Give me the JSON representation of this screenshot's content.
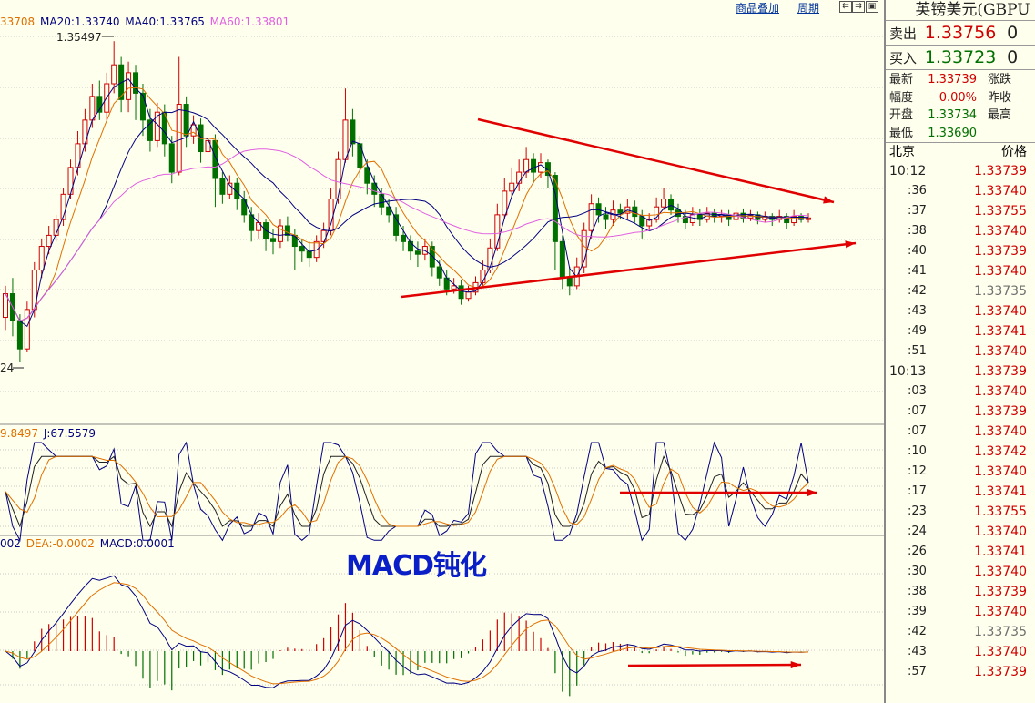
{
  "top_links": [
    "商品叠加",
    "周期"
  ],
  "ma_legend": [
    {
      "text": "33708",
      "color": "#E07000"
    },
    {
      "text": "MA20:1.33740",
      "color": "#000080"
    },
    {
      "text": "MA40:1.33765",
      "color": "#000080"
    },
    {
      "text": "MA60:1.33801",
      "color": "#E060E0"
    }
  ],
  "kdj_legend": [
    {
      "text": "9.8497",
      "color": "#E07000"
    },
    {
      "text": "J:67.5579",
      "color": "#000080"
    }
  ],
  "macd_legend": [
    {
      "text": "002",
      "color": "#000080"
    },
    {
      "text": "DEA:-0.0002",
      "color": "#E07000"
    },
    {
      "text": "MACD:0.0001",
      "color": "#000080"
    }
  ],
  "annotations": {
    "high_label": "1.35497",
    "low_label": "24",
    "macd_text": "MACD钝化"
  },
  "colors": {
    "up": "#D00000",
    "down": "#007000",
    "price_red": "#D00000",
    "price_green": "#007000",
    "price_gray": "#707070",
    "annotation_arrow": "#E00000"
  },
  "side": {
    "title": "英镑美元(GBPU",
    "sell": {
      "label": "卖出",
      "price": "1.33756",
      "vol": "0"
    },
    "buy": {
      "label": "买入",
      "price": "1.33723",
      "vol": "0"
    },
    "stats": [
      {
        "label": "最新",
        "value": "1.33739",
        "color": "#D00000",
        "label2": "涨跌"
      },
      {
        "label": "幅度",
        "value": "0.00%",
        "color": "#D00000",
        "label2": "昨收"
      },
      {
        "label": "开盘",
        "value": "1.33734",
        "color": "#007000",
        "label2": "最高"
      },
      {
        "label": "最低",
        "value": "1.33690",
        "color": "#007000",
        "label2": ""
      }
    ],
    "ticks_header": {
      "left": "北京",
      "right": "价格"
    },
    "ticks": [
      {
        "time": "10:12",
        "price": "1.33739",
        "color": "#D00000",
        "big": true
      },
      {
        "time": ":36",
        "price": "1.33740",
        "color": "#D00000"
      },
      {
        "time": ":37",
        "price": "1.33755",
        "color": "#D00000"
      },
      {
        "time": ":38",
        "price": "1.33740",
        "color": "#D00000"
      },
      {
        "time": ":40",
        "price": "1.33739",
        "color": "#D00000"
      },
      {
        "time": ":41",
        "price": "1.33740",
        "color": "#D00000"
      },
      {
        "time": ":42",
        "price": "1.33735",
        "color": "#707070"
      },
      {
        "time": ":43",
        "price": "1.33740",
        "color": "#D00000"
      },
      {
        "time": ":49",
        "price": "1.33741",
        "color": "#D00000"
      },
      {
        "time": ":51",
        "price": "1.33740",
        "color": "#D00000"
      },
      {
        "time": "10:13",
        "price": "1.33739",
        "color": "#D00000",
        "big": true
      },
      {
        "time": ":03",
        "price": "1.33740",
        "color": "#D00000"
      },
      {
        "time": ":07",
        "price": "1.33739",
        "color": "#D00000"
      },
      {
        "time": ":07",
        "price": "1.33740",
        "color": "#D00000"
      },
      {
        "time": ":10",
        "price": "1.33742",
        "color": "#D00000"
      },
      {
        "time": ":12",
        "price": "1.33740",
        "color": "#D00000"
      },
      {
        "time": ":17",
        "price": "1.33741",
        "color": "#D00000"
      },
      {
        "time": ":23",
        "price": "1.33755",
        "color": "#D00000"
      },
      {
        "time": ":24",
        "price": "1.33740",
        "color": "#D00000"
      },
      {
        "time": ":26",
        "price": "1.33741",
        "color": "#D00000"
      },
      {
        "time": ":30",
        "price": "1.33740",
        "color": "#D00000"
      },
      {
        "time": ":38",
        "price": "1.33739",
        "color": "#D00000"
      },
      {
        "time": ":39",
        "price": "1.33740",
        "color": "#D00000"
      },
      {
        "time": ":42",
        "price": "1.33735",
        "color": "#707070"
      },
      {
        "time": ":43",
        "price": "1.33740",
        "color": "#D00000"
      },
      {
        "time": ":57",
        "price": "1.33739",
        "color": "#D00000"
      }
    ]
  },
  "chart_data": {
    "type": "candlestick",
    "panels": [
      "price",
      "kdj",
      "macd"
    ],
    "candles": [
      [
        0.3,
        0.45,
        0.5,
        0.22
      ],
      [
        0.45,
        0.28,
        0.55,
        0.18
      ],
      [
        0.28,
        0.1,
        0.32,
        0.02
      ],
      [
        0.1,
        0.35,
        0.4,
        0.08
      ],
      [
        0.35,
        0.6,
        0.65,
        0.3
      ],
      [
        0.6,
        0.75,
        0.8,
        0.55
      ],
      [
        0.75,
        0.82,
        0.88,
        0.7
      ],
      [
        0.82,
        0.92,
        0.95,
        0.78
      ],
      [
        0.92,
        1.08,
        1.12,
        0.88
      ],
      [
        1.08,
        1.25,
        1.3,
        1.05
      ],
      [
        1.25,
        1.4,
        1.48,
        1.2
      ],
      [
        1.4,
        1.55,
        1.62,
        1.35
      ],
      [
        1.55,
        1.7,
        1.78,
        1.5
      ],
      [
        1.7,
        1.6,
        1.8,
        1.55
      ],
      [
        1.6,
        1.78,
        1.85,
        1.55
      ],
      [
        1.78,
        1.9,
        2.05,
        1.72
      ],
      [
        1.9,
        1.68,
        1.95,
        1.6
      ],
      [
        1.68,
        1.85,
        1.92,
        1.6
      ],
      [
        1.85,
        1.72,
        1.9,
        1.55
      ],
      [
        1.72,
        1.55,
        1.78,
        1.45
      ],
      [
        1.55,
        1.42,
        1.62,
        1.35
      ],
      [
        1.42,
        1.6,
        1.66,
        1.38
      ],
      [
        1.6,
        1.4,
        1.65,
        1.32
      ],
      [
        1.4,
        1.22,
        1.45,
        1.15
      ],
      [
        1.22,
        1.65,
        1.95,
        1.2
      ],
      [
        1.65,
        1.45,
        1.7,
        1.38
      ],
      [
        1.45,
        1.52,
        1.58,
        1.4
      ],
      [
        1.52,
        1.35,
        1.56,
        1.28
      ],
      [
        1.35,
        1.42,
        1.48,
        1.3
      ],
      [
        1.42,
        1.18,
        1.46,
        1.0
      ],
      [
        1.18,
        1.08,
        1.22,
        1.02
      ],
      [
        1.08,
        1.15,
        1.2,
        1.05
      ],
      [
        1.15,
        1.05,
        1.18,
        0.98
      ],
      [
        1.05,
        0.95,
        1.1,
        0.9
      ],
      [
        0.95,
        0.85,
        1.0,
        0.78
      ],
      [
        0.85,
        0.9,
        0.96,
        0.8
      ],
      [
        0.9,
        0.8,
        0.92,
        0.72
      ],
      [
        0.8,
        0.78,
        0.86,
        0.7
      ],
      [
        0.78,
        0.88,
        0.92,
        0.74
      ],
      [
        0.88,
        0.82,
        0.94,
        0.78
      ],
      [
        0.82,
        0.75,
        0.86,
        0.6
      ],
      [
        0.75,
        0.72,
        0.8,
        0.65
      ],
      [
        0.72,
        0.68,
        0.78,
        0.62
      ],
      [
        0.68,
        0.78,
        0.82,
        0.65
      ],
      [
        0.78,
        0.85,
        0.9,
        0.74
      ],
      [
        0.85,
        1.05,
        1.12,
        0.82
      ],
      [
        1.05,
        1.3,
        1.35,
        1.02
      ],
      [
        1.3,
        1.55,
        1.75,
        1.28
      ],
      [
        1.55,
        1.4,
        1.62,
        1.32
      ],
      [
        1.4,
        1.25,
        1.45,
        1.18
      ],
      [
        1.25,
        1.15,
        1.3,
        1.08
      ],
      [
        1.15,
        1.08,
        1.2,
        1.0
      ],
      [
        1.08,
        1.0,
        1.12,
        0.95
      ],
      [
        1.0,
        0.95,
        1.05,
        0.9
      ],
      [
        0.95,
        0.82,
        1.0,
        0.78
      ],
      [
        0.82,
        0.78,
        0.88,
        0.72
      ],
      [
        0.78,
        0.72,
        0.82,
        0.66
      ],
      [
        0.72,
        0.7,
        0.78,
        0.62
      ],
      [
        0.7,
        0.75,
        0.8,
        0.66
      ],
      [
        0.75,
        0.62,
        0.78,
        0.56
      ],
      [
        0.62,
        0.55,
        0.66,
        0.5
      ],
      [
        0.55,
        0.48,
        0.6,
        0.44
      ],
      [
        0.48,
        0.5,
        0.55,
        0.45
      ],
      [
        0.5,
        0.42,
        0.54,
        0.38
      ],
      [
        0.42,
        0.46,
        0.5,
        0.4
      ],
      [
        0.46,
        0.52,
        0.56,
        0.44
      ],
      [
        0.52,
        0.6,
        0.66,
        0.5
      ],
      [
        0.6,
        0.74,
        0.8,
        0.58
      ],
      [
        0.74,
        0.95,
        1.02,
        0.72
      ],
      [
        0.95,
        1.1,
        1.18,
        0.92
      ],
      [
        1.1,
        1.15,
        1.25,
        1.05
      ],
      [
        1.15,
        1.22,
        1.3,
        1.1
      ],
      [
        1.22,
        1.3,
        1.38,
        1.18
      ],
      [
        1.3,
        1.22,
        1.34,
        1.15
      ],
      [
        1.22,
        1.28,
        1.34,
        1.18
      ],
      [
        1.28,
        1.2,
        1.3,
        1.12
      ],
      [
        1.2,
        0.78,
        1.22,
        0.6
      ],
      [
        0.78,
        0.55,
        0.82,
        0.48
      ],
      [
        0.55,
        0.5,
        0.62,
        0.44
      ],
      [
        0.5,
        0.62,
        0.68,
        0.48
      ],
      [
        0.62,
        0.85,
        0.9,
        0.58
      ],
      [
        0.85,
        1.02,
        1.08,
        0.8
      ],
      [
        1.02,
        0.95,
        1.06,
        0.9
      ],
      [
        0.95,
        0.92,
        1.0,
        0.86
      ],
      [
        0.92,
        0.98,
        1.04,
        0.88
      ],
      [
        0.98,
        0.96,
        1.02,
        0.92
      ],
      [
        0.96,
        1.0,
        1.05,
        0.92
      ],
      [
        1.0,
        0.94,
        1.04,
        0.9
      ],
      [
        0.94,
        0.88,
        0.98,
        0.8
      ],
      [
        0.88,
        0.92,
        0.96,
        0.85
      ],
      [
        0.92,
        1.0,
        1.06,
        0.9
      ],
      [
        1.0,
        1.05,
        1.12,
        0.98
      ],
      [
        1.05,
        0.98,
        1.08,
        0.95
      ],
      [
        0.98,
        0.94,
        1.02,
        0.9
      ],
      [
        0.94,
        0.9,
        0.98,
        0.86
      ],
      [
        0.9,
        0.95,
        1.0,
        0.88
      ],
      [
        0.95,
        0.92,
        0.99,
        0.88
      ],
      [
        0.92,
        0.96,
        1.0,
        0.9
      ],
      [
        0.96,
        0.94,
        0.99,
        0.9
      ],
      [
        0.94,
        0.95,
        0.98,
        0.9
      ],
      [
        0.95,
        0.92,
        0.98,
        0.88
      ],
      [
        0.92,
        0.96,
        1.0,
        0.9
      ],
      [
        0.96,
        0.93,
        0.99,
        0.9
      ],
      [
        0.93,
        0.95,
        0.98,
        0.91
      ],
      [
        0.95,
        0.92,
        0.97,
        0.89
      ],
      [
        0.92,
        0.94,
        0.97,
        0.9
      ],
      [
        0.94,
        0.92,
        0.96,
        0.88
      ],
      [
        0.92,
        0.94,
        0.98,
        0.9
      ],
      [
        0.94,
        0.9,
        0.96,
        0.86
      ],
      [
        0.9,
        0.94,
        0.98,
        0.88
      ],
      [
        0.94,
        0.92,
        0.96,
        0.9
      ],
      [
        0.92,
        0.93,
        0.96,
        0.9
      ]
    ]
  }
}
